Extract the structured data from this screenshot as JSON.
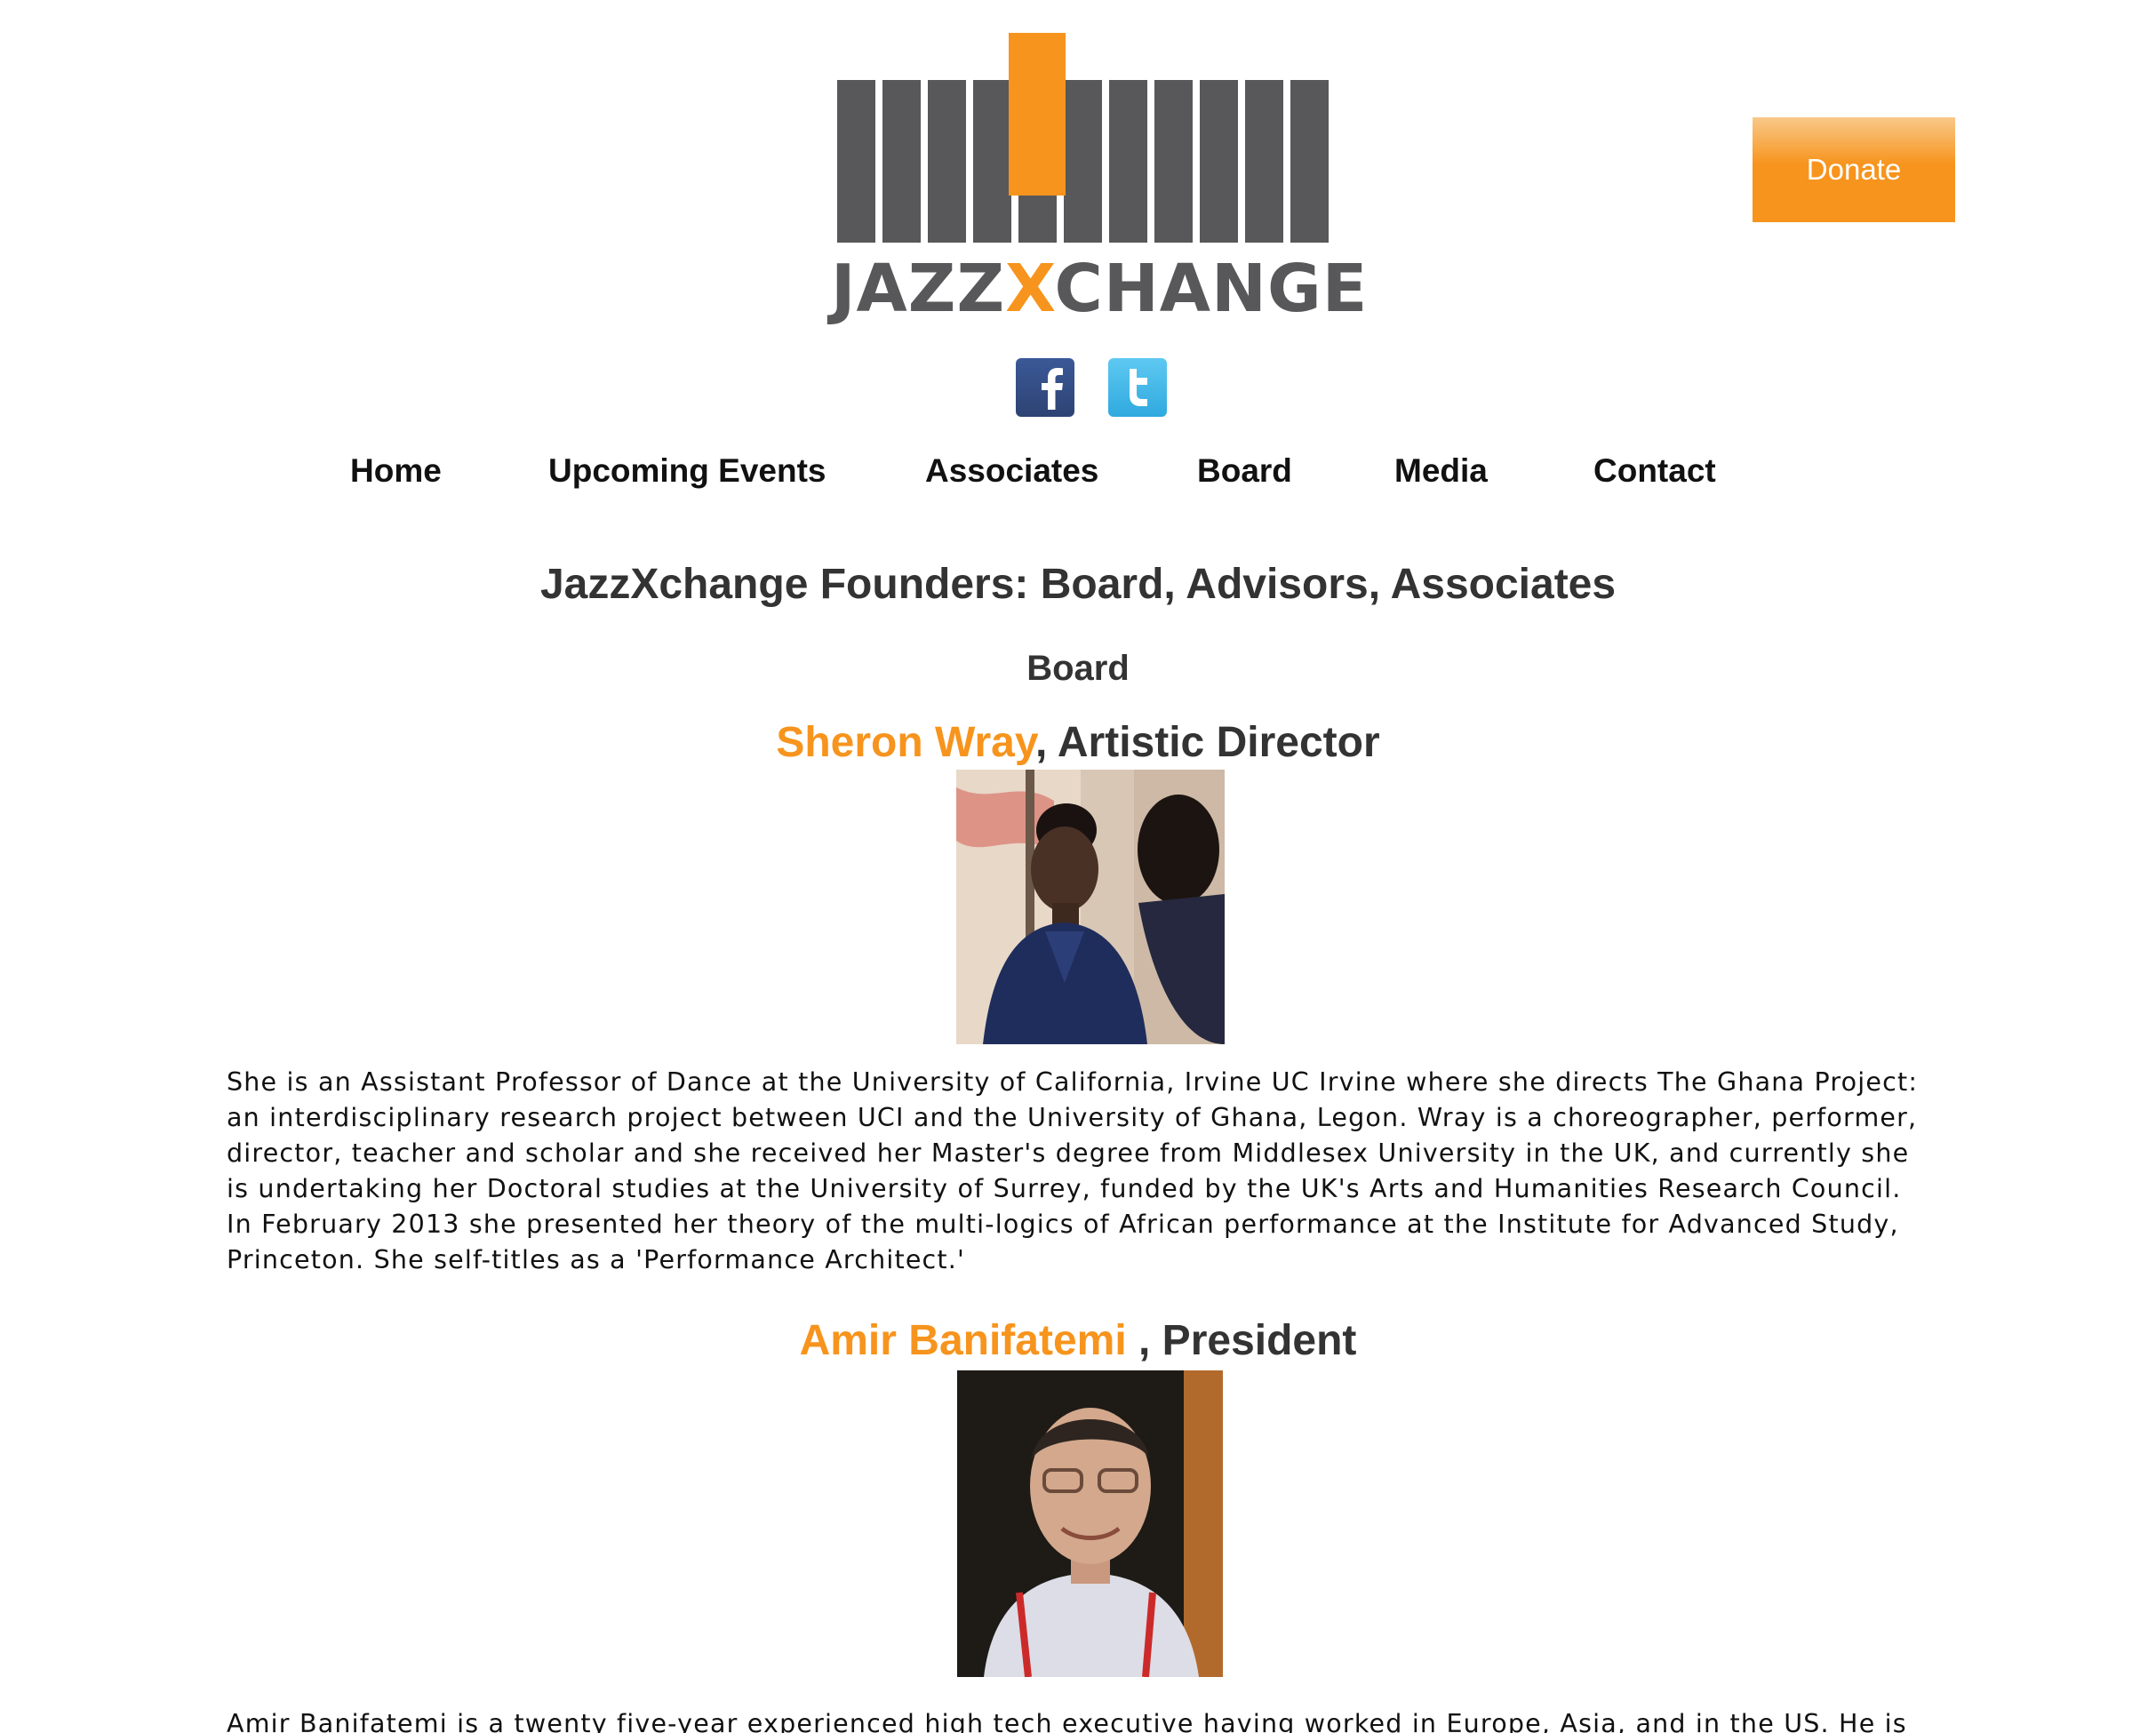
{
  "header": {
    "logo": {
      "text_left": "JAZZ",
      "text_x": "X",
      "text_right": "CHANGE",
      "icon": "piano-keys-logo",
      "colors": {
        "gray": "#58585a",
        "orange": "#f7941d"
      }
    },
    "donate_label": "Donate",
    "social": [
      {
        "name": "facebook",
        "icon": "facebook-icon"
      },
      {
        "name": "twitter",
        "icon": "twitter-icon"
      }
    ]
  },
  "nav": {
    "items": [
      {
        "label": "Home"
      },
      {
        "label": "Upcoming Events"
      },
      {
        "label": "Associates"
      },
      {
        "label": "Board"
      },
      {
        "label": "Media"
      },
      {
        "label": "Contact"
      }
    ]
  },
  "main": {
    "title": "JazzXchange Founders: Board, Advisors, Associates",
    "section": "Board",
    "people": [
      {
        "name": "Sheron Wray",
        "role": ", Artistic Director",
        "bio": "She is an Assistant Professor of Dance at the University of California, Irvine UC Irvine where she directs The Ghana Project: an interdisciplinary research project between UCI and the University of Ghana, Legon. Wray is a choreographer, performer, director, teacher and scholar and she received her Master's degree from Middlesex University in the UK, and currently she is undertaking her Doctoral studies at the University of Surrey, funded by the UK's Arts and Humanities Research Council. In February 2013 she presented her theory of the multi-logics of African performance at the Institute for Advanced Study, Princeton. She self-titles as a 'Performance Architect.'"
      },
      {
        "name": "Amir Banifatemi ",
        "role": ", President",
        "bio": "Amir Banifatemi is a twenty five-year experienced high tech executive having worked in Europe, Asia, and in the US. He is both an"
      }
    ]
  },
  "colors": {
    "accent": "#f7941d",
    "heading": "#333333",
    "text": "#111111"
  }
}
